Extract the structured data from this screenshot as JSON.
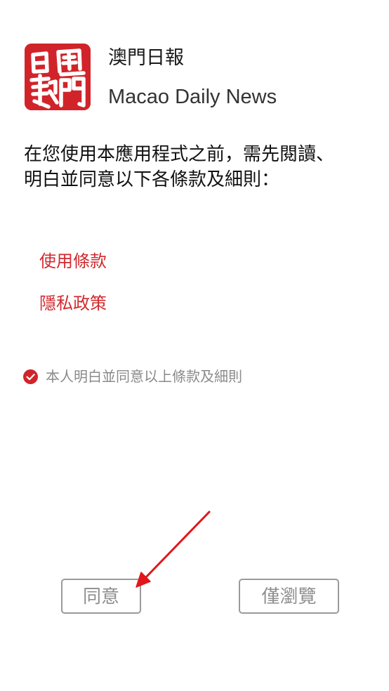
{
  "app": {
    "name_zh": "澳門日報",
    "name_en": "Macao Daily News",
    "logo_text": "日報澳門"
  },
  "intro": {
    "line1": "在您使用本應用程式之前，需先閱讀、",
    "line2": "明白並同意以下各條款及細則："
  },
  "links": {
    "terms": "使用條款",
    "privacy": "隱私政策"
  },
  "consent": {
    "label": "本人明白並同意以上條款及細則",
    "checked": true
  },
  "buttons": {
    "agree": "同意",
    "browse_only": "僅瀏覽"
  },
  "colors": {
    "brand_red": "#d1242a",
    "link_red": "#d12a2f",
    "arrow_red": "#e0161c",
    "muted_gray": "#8a8a8a",
    "button_border": "#9a9a9a"
  },
  "icons": {
    "consent_check": "check-circle-icon",
    "annotation": "red-arrow-icon"
  }
}
